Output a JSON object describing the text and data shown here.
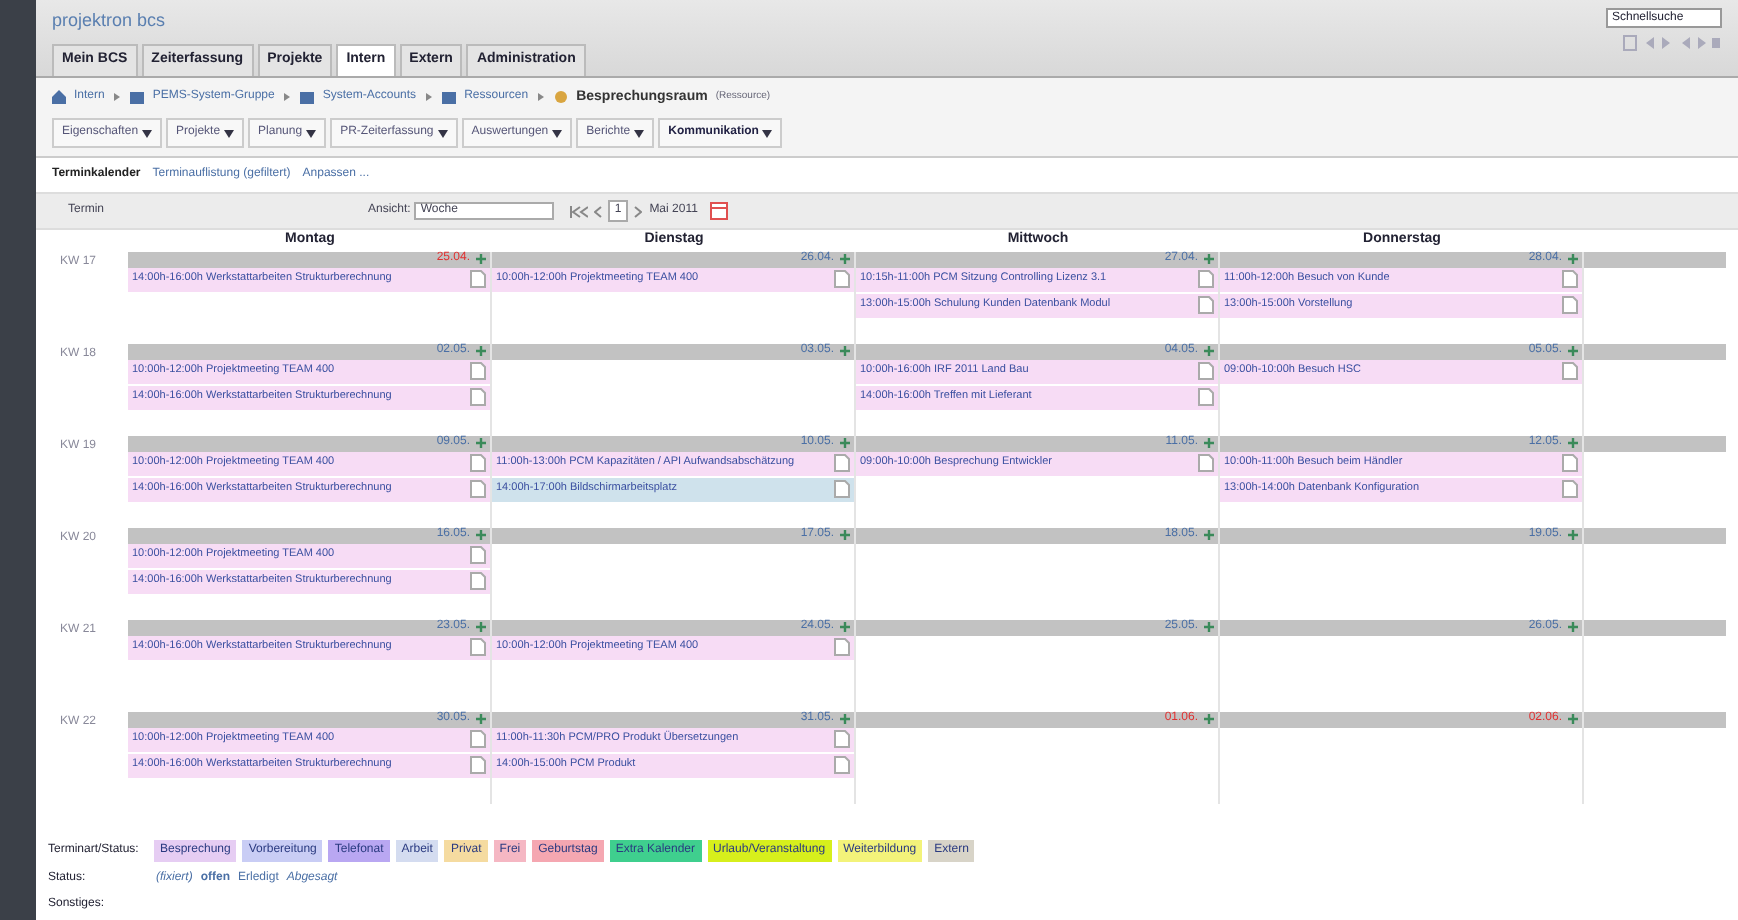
{
  "logo": "projektron bcs",
  "search": {
    "value": "Schnellsuche"
  },
  "main_tabs": [
    {
      "label": "Mein BCS",
      "selected": false
    },
    {
      "label": "Zeiterfassung",
      "selected": false
    },
    {
      "label": "Projekte",
      "selected": false
    },
    {
      "label": "Intern",
      "selected": true
    },
    {
      "label": "Extern",
      "selected": false
    },
    {
      "label": "Administration",
      "selected": false
    }
  ],
  "breadcrumb": [
    "Intern",
    "PEMS-System-Gruppe",
    "System-Accounts",
    "Ressourcen"
  ],
  "breadcrumb_current": {
    "label": "Besprechungsraum",
    "type": "(Ressource)"
  },
  "menu": [
    {
      "label": "Eigenschaften",
      "selected": false
    },
    {
      "label": "Projekte",
      "selected": false
    },
    {
      "label": "Planung",
      "selected": false
    },
    {
      "label": "PR-Zeiterfassung",
      "selected": false
    },
    {
      "label": "Auswertungen",
      "selected": false
    },
    {
      "label": "Berichte",
      "selected": false
    },
    {
      "label": "Kommunikation",
      "selected": true
    }
  ],
  "sub_tabs": [
    {
      "label": "Terminkalender",
      "selected": true
    },
    {
      "label": "Terminauflistung (gefiltert)",
      "selected": false
    }
  ],
  "customize": "Anpassen ...",
  "toolbar": {
    "new": "Termin",
    "view_label": "Ansicht:",
    "view_value": "Woche",
    "page": "1",
    "month": "Mai 2011"
  },
  "days": [
    "Montag",
    "Dienstag",
    "Mittwoch",
    "Donnerstag"
  ],
  "weeks": [
    {
      "label": "KW 17",
      "days": [
        {
          "date": "25.04.",
          "holiday": true,
          "events": [
            {
              "text": "14:00h-16:00h Werkstattarbeiten Strukturberechnung",
              "color": "#f7dcf5"
            }
          ]
        },
        {
          "date": "26.04.",
          "holiday": false,
          "events": [
            {
              "text": "10:00h-12:00h Projektmeeting TEAM 400",
              "color": "#f7dcf5"
            }
          ]
        },
        {
          "date": "27.04.",
          "holiday": false,
          "events": [
            {
              "text": "10:15h-11:00h PCM Sitzung Controlling Lizenz 3.1",
              "color": "#f7dcf5"
            },
            {
              "text": "13:00h-15:00h Schulung Kunden Datenbank Modul",
              "color": "#f7dcf5"
            }
          ]
        },
        {
          "date": "28.04.",
          "holiday": false,
          "events": [
            {
              "text": "11:00h-12:00h Besuch von Kunde",
              "color": "#f7dcf5"
            },
            {
              "text": "13:00h-15:00h Vorstellung",
              "color": "#f7dcf5"
            }
          ]
        }
      ]
    },
    {
      "label": "KW 18",
      "days": [
        {
          "date": "02.05.",
          "holiday": false,
          "events": [
            {
              "text": "10:00h-12:00h Projektmeeting TEAM 400",
              "color": "#f7dcf5"
            },
            {
              "text": "14:00h-16:00h Werkstattarbeiten Strukturberechnung",
              "color": "#f7dcf5"
            }
          ]
        },
        {
          "date": "03.05.",
          "holiday": false
        },
        {
          "date": "04.05.",
          "holiday": false,
          "events": [
            {
              "text": "10:00h-16:00h IRF 2011 Land Bau",
              "color": "#f7dcf5"
            },
            {
              "text": "14:00h-16:00h Treffen mit Lieferant",
              "color": "#f7dcf5"
            }
          ]
        },
        {
          "date": "05.05.",
          "holiday": false,
          "events": [
            {
              "text": "09:00h-10:00h Besuch HSC",
              "color": "#f7dcf5"
            }
          ]
        }
      ]
    },
    {
      "label": "KW 19",
      "days": [
        {
          "date": "09.05.",
          "holiday": false,
          "events": [
            {
              "text": "10:00h-12:00h Projektmeeting TEAM 400",
              "color": "#f7dcf5"
            },
            {
              "text": "14:00h-16:00h Werkstattarbeiten Strukturberechnung",
              "color": "#f7dcf5"
            }
          ]
        },
        {
          "date": "10.05.",
          "holiday": false,
          "events": [
            {
              "text": "11:00h-13:00h PCM Kapazitäten / API Aufwandsabschätzung",
              "color": "#f7dcf5"
            },
            {
              "text": "14:00h-17:00h Bildschirmarbeitsplatz",
              "color": "#cfe2ec"
            }
          ]
        },
        {
          "date": "11.05.",
          "holiday": false,
          "events": [
            {
              "text": "09:00h-10:00h Besprechung Entwickler",
              "color": "#f7dcf5"
            }
          ]
        },
        {
          "date": "12.05.",
          "holiday": false,
          "events": [
            {
              "text": "10:00h-11:00h Besuch beim Händler",
              "color": "#f7dcf5"
            },
            {
              "text": "13:00h-14:00h Datenbank Konfiguration",
              "color": "#f7dcf5"
            }
          ]
        }
      ]
    },
    {
      "label": "KW 20",
      "days": [
        {
          "date": "16.05.",
          "holiday": false,
          "events": [
            {
              "text": "10:00h-12:00h Projektmeeting TEAM 400",
              "color": "#f7dcf5"
            },
            {
              "text": "14:00h-16:00h Werkstattarbeiten Strukturberechnung",
              "color": "#f7dcf5"
            }
          ]
        },
        {
          "date": "17.05.",
          "holiday": false
        },
        {
          "date": "18.05.",
          "holiday": false
        },
        {
          "date": "19.05.",
          "holiday": false
        }
      ]
    },
    {
      "label": "KW 21",
      "days": [
        {
          "date": "23.05.",
          "holiday": false,
          "events": [
            {
              "text": "14:00h-16:00h Werkstattarbeiten Strukturberechnung",
              "color": "#f7dcf5"
            }
          ]
        },
        {
          "date": "24.05.",
          "holiday": false,
          "events": [
            {
              "text": "10:00h-12:00h Projektmeeting TEAM 400",
              "color": "#f7dcf5"
            }
          ]
        },
        {
          "date": "25.05.",
          "holiday": false
        },
        {
          "date": "26.05.",
          "holiday": false
        }
      ]
    },
    {
      "label": "KW 22",
      "days": [
        {
          "date": "30.05.",
          "holiday": false,
          "events": [
            {
              "text": "10:00h-12:00h Projektmeeting TEAM 400",
              "color": "#f7dcf5"
            },
            {
              "text": "14:00h-16:00h Werkstattarbeiten Strukturberechnung",
              "color": "#f7dcf5"
            }
          ]
        },
        {
          "date": "31.05.",
          "holiday": false,
          "events": [
            {
              "text": "11:00h-11:30h PCM/PRO Produkt Übersetzungen",
              "color": "#f7dcf5"
            },
            {
              "text": "14:00h-15:00h PCM Produkt",
              "color": "#f7dcf5"
            }
          ]
        },
        {
          "date": "01.06.",
          "holiday": true
        },
        {
          "date": "02.06.",
          "holiday": true
        }
      ]
    }
  ],
  "legend_label": "Terminart/Status:",
  "legend": [
    {
      "label": "Besprechung",
      "color": "#e6cdf3"
    },
    {
      "label": "Vorbereitung",
      "color": "#c9cdf5"
    },
    {
      "label": "Telefonat",
      "color": "#b9a7f2"
    },
    {
      "label": "Arbeit",
      "color": "#d4dcf0"
    },
    {
      "label": "Privat",
      "color": "#f5dba0"
    },
    {
      "label": "Frei",
      "color": "#f5b7c3"
    },
    {
      "label": "Geburtstag",
      "color": "#f5a7b1"
    },
    {
      "label": "Extra Kalender",
      "color": "#3fcf8e"
    },
    {
      "label": "Urlaub/Veranstaltung",
      "color": "#d7ef1c"
    },
    {
      "label": "Weiterbildung",
      "color": "#f3f37a"
    },
    {
      "label": "Extern",
      "color": "#d8d4c8"
    }
  ],
  "status_label": "Status:",
  "statuses": [
    {
      "label": "(fixiert)",
      "kind": "italic"
    },
    {
      "label": "offen",
      "kind": "bold"
    },
    {
      "label": "Erledigt",
      "kind": "plain"
    },
    {
      "label": "Abgesagt",
      "kind": "italic"
    }
  ],
  "other_label": "Sonstiges:"
}
